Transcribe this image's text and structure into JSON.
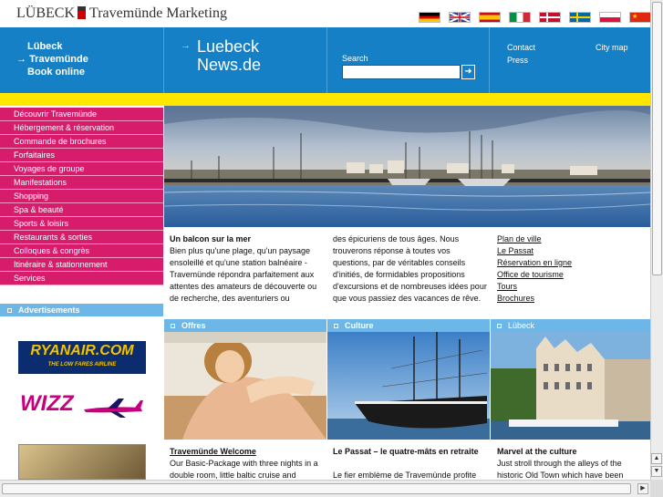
{
  "header": {
    "logo_text": "LÜBECK",
    "logo_text2": "Travemünde Marketing",
    "languages": [
      "German",
      "English",
      "Spanish",
      "Italian",
      "Danish",
      "Swedish",
      "Polish",
      "Chinese"
    ]
  },
  "nav": {
    "left_links": [
      "Lübeck",
      "Travemünde",
      "Book online"
    ],
    "news_title1": "Luebeck",
    "news_title2": "News.de",
    "search_label": "Search",
    "search_value": "",
    "right_links": [
      "Contact",
      "City map",
      "Press"
    ]
  },
  "sidebar": {
    "items": [
      "Découvrir Travemünde",
      "Hébergement & réservation",
      "Commande de brochures",
      "Forfaitaires",
      "Voyages de groupe",
      "Manifestations",
      "Shopping",
      "Spa & beauté",
      "Sports & loisirs",
      "Restaurants & sorties",
      "Colloques & congrès",
      "Itinéraire & stationnement",
      "Services"
    ],
    "ads_heading": "Advertisements",
    "ryanair": "RYANAIR.COM",
    "ryanair_tag": "THE LOW FARES AIRLINE",
    "wizz": "WIZZ"
  },
  "intro": {
    "heading": "Un balcon sur la mer",
    "col1": "Bien plus qu'une plage, qu'un paysage ensoleillé et qu'une station balnéaire - Travemünde répondra parfaitement aux attentes des amateurs de découverte ou de recherche, des aventuriers ou",
    "col2": "des épicuriens de tous âges. Nous trouverons réponse à toutes vos questions, par de véritables conseils d'initiés, de formidables propositions d'excursions et de nombreuses idées pour que vous passiez des vacances de rêve.",
    "links": [
      "Plan de ville",
      "Le Passat",
      "Réservation en ligne",
      "Office de tourisme",
      "Tours",
      "Brochures"
    ]
  },
  "sections": [
    {
      "heading": "Offres",
      "title": "Travemünde Welcome",
      "text": "Our Basic-Package with three nights in a double room, little baltic cruise and"
    },
    {
      "heading": "Culture",
      "title": "Le Passat – le quatre-mâts en retraite",
      "text": "Le fier emblème de Travemünde profite"
    },
    {
      "heading": "Lübeck",
      "title": "Marvel at the culture",
      "text": "Just stroll through the alleys of the historic Old Town which have been"
    }
  ],
  "colors": {
    "nav_blue": "#1580c6",
    "accent_yellow": "#ffe600",
    "menu_pink": "#d81c6c",
    "section_blue": "#6db7e8"
  }
}
